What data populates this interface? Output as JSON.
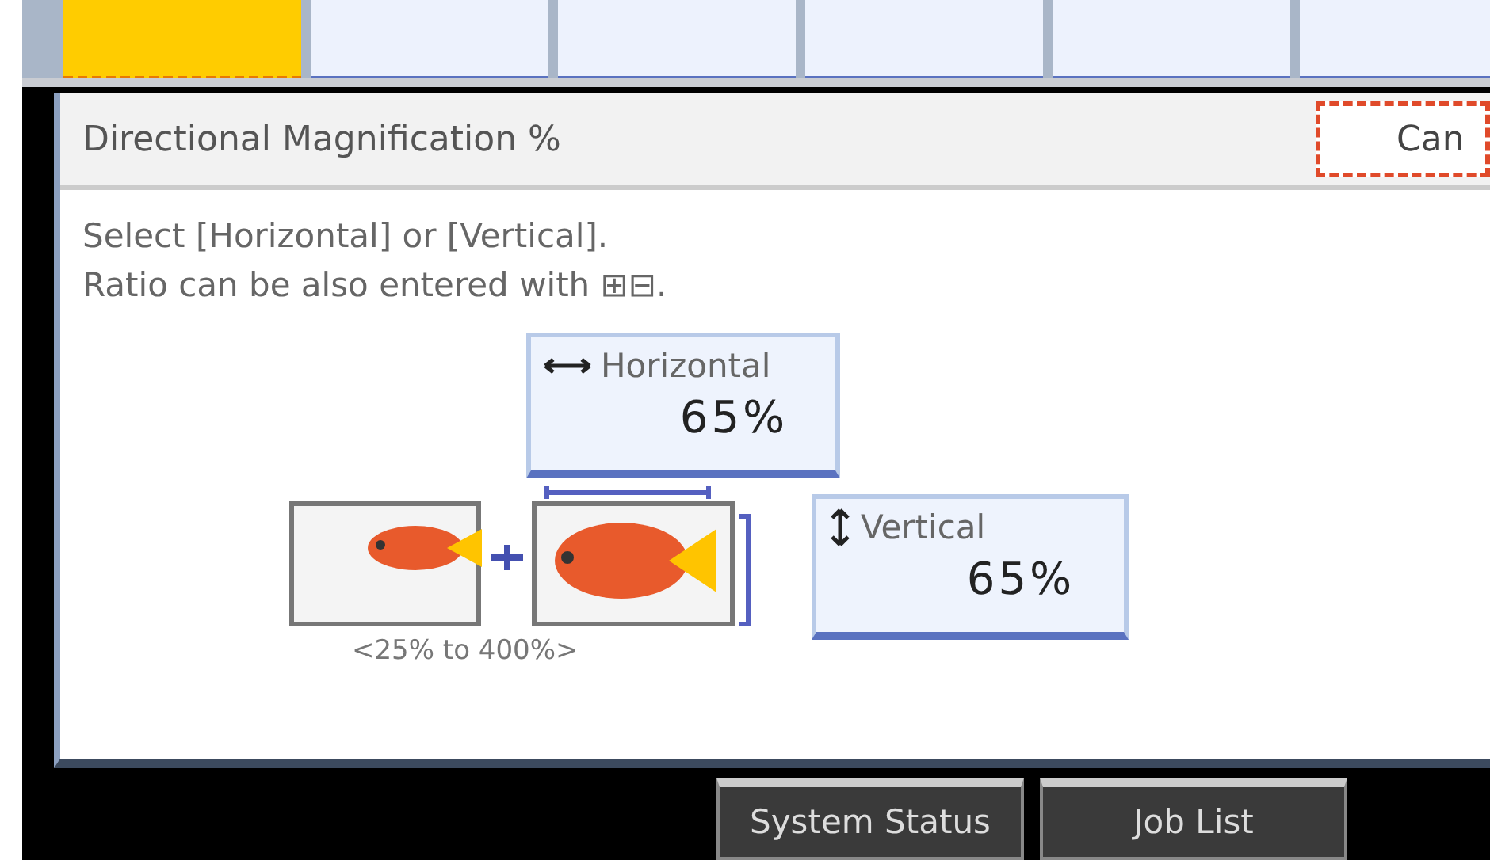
{
  "tabs": [
    {
      "selected": true
    },
    {
      "selected": false
    },
    {
      "selected": false
    },
    {
      "selected": false
    },
    {
      "selected": false
    },
    {
      "selected": false
    }
  ],
  "dialog": {
    "title": "Directional Magnification %",
    "cancel_button": "Can",
    "instructions": [
      "Select [Horizontal] or [Vertical].",
      "Ratio can be also entered with ⊞⊟."
    ],
    "options": [
      {
        "kind": "horizontal",
        "label": "Horizontal",
        "value": "65%"
      },
      {
        "kind": "vertical",
        "label": "Vertical",
        "value": "65%"
      }
    ],
    "range": "<25% to 400%>"
  },
  "footer_buttons": [
    "System Status",
    "Job List"
  ]
}
